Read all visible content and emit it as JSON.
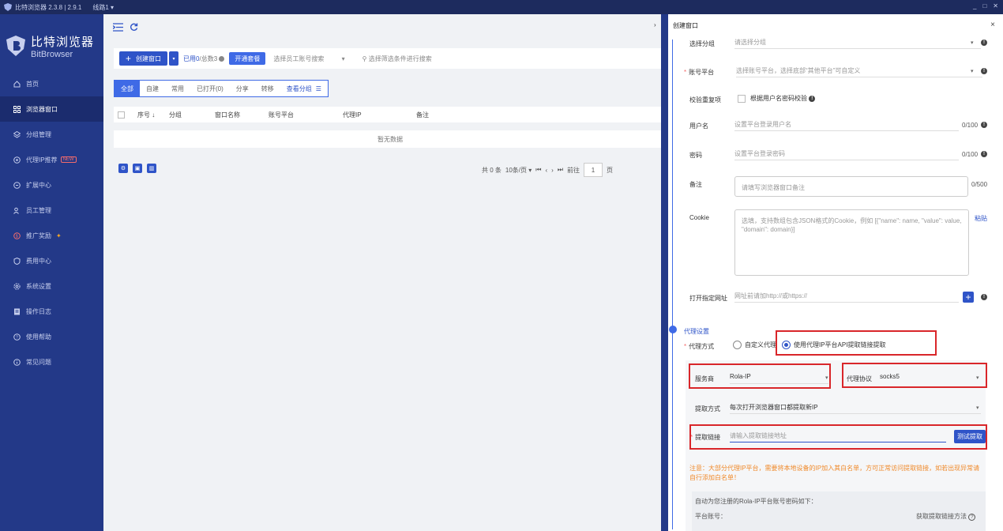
{
  "titlebar": {
    "app": "比特浏览器 2.3.8 | 2.9.1",
    "route": "线路1",
    "route_arrow": "▾",
    "min": "_",
    "max": "□",
    "close": "✕"
  },
  "sidebar": {
    "brand_cn": "比特浏览器",
    "brand_en": "BitBrowser",
    "items": [
      {
        "label": "首页",
        "icon": "home-icon"
      },
      {
        "label": "浏览器窗口",
        "icon": "grid-icon"
      },
      {
        "label": "分组管理",
        "icon": "layers-icon"
      },
      {
        "label": "代理IP推荐",
        "icon": "location-icon",
        "badge": "NEW"
      },
      {
        "label": "扩展中心",
        "icon": "puzzle-icon"
      },
      {
        "label": "员工管理",
        "icon": "users-icon"
      },
      {
        "label": "推广奖励",
        "icon": "gift-icon"
      },
      {
        "label": "费用中心",
        "icon": "shield-icon"
      },
      {
        "label": "系统设置",
        "icon": "gear-icon"
      },
      {
        "label": "操作日志",
        "icon": "log-icon"
      },
      {
        "label": "使用帮助",
        "icon": "help-icon"
      },
      {
        "label": "常见问题",
        "icon": "info-icon"
      }
    ],
    "active_index": 1,
    "colors": {
      "bg": "#233988",
      "active": "#1b2c6e"
    }
  },
  "main": {
    "toolbar": {
      "create_label": "创建窗口",
      "used_label": "已用0",
      "total_label": "/总数3",
      "package_label": "开通套餐",
      "staff_search": "选择员工账号搜索",
      "filter_search": "选择筛选条件进行搜索"
    },
    "tabs": [
      "全部",
      "自建",
      "常用",
      "已打开(0)",
      "分享",
      "转移"
    ],
    "group_link": "查看分组",
    "columns": [
      "序号 ↓",
      "分组",
      "窗口名称",
      "账号平台",
      "代理IP",
      "备注"
    ],
    "empty_text": "暂无数据",
    "pager": {
      "total": "共 0 条",
      "per_page": "10条/页",
      "goto": "前往",
      "page": "1",
      "page_suffix": "页"
    }
  },
  "drawer": {
    "title": "创建窗口",
    "close": "×",
    "group": {
      "label": "选择分组",
      "placeholder": "请选择分组"
    },
    "platform": {
      "label": "账号平台",
      "placeholder": "选择账号平台，选择底部“其他平台”可自定义"
    },
    "dup_check": {
      "label": "校验重复项",
      "option": "根据用户名密码校验"
    },
    "username": {
      "label": "用户名",
      "placeholder": "设置平台登录用户名",
      "count": "0/100"
    },
    "password": {
      "label": "密码",
      "placeholder": "设置平台登录密码",
      "count": "0/100"
    },
    "remark": {
      "label": "备注",
      "placeholder": "请填写浏览器窗口备注",
      "count": "0/500"
    },
    "cookie": {
      "label": "Cookie",
      "placeholder": "选填，支持数组包含JSON格式的Cookie，例如 [{\"name\": name, \"value\": value, \"domain\": domain}]",
      "paste": "粘贴"
    },
    "url": {
      "label": "打开指定网址",
      "placeholder": "网址前请加http://或https://"
    },
    "proxy_section": "代理设置",
    "proxy_method": {
      "label": "代理方式",
      "option_custom": "自定义代理",
      "option_api": "使用代理IP平台API提取链接提取"
    },
    "provider": {
      "label": "服务商",
      "value": "Rola-IP"
    },
    "protocol": {
      "label": "代理协议",
      "value": "socks5"
    },
    "extract_mode": {
      "label": "提取方式",
      "value": "每次打开浏览器窗口都提取新IP"
    },
    "extract_link": {
      "label": "提取链接",
      "placeholder": "请输入提取链接地址",
      "test": "测试提取"
    },
    "notice": "注意：大部分代理IP平台，需要将本地设备的IP加入其白名单，方可正常访问提取链接，如若出现异常请自行添加白名单！",
    "auto_info": "自动为您注册的Rola-IP平台账号密码如下：",
    "platform_account": "平台账号：",
    "get_method": "获取提取链接方法"
  },
  "colors": {
    "primary": "#2f54c8",
    "highlight": "#d9262a",
    "warning": "#f08a2b"
  }
}
